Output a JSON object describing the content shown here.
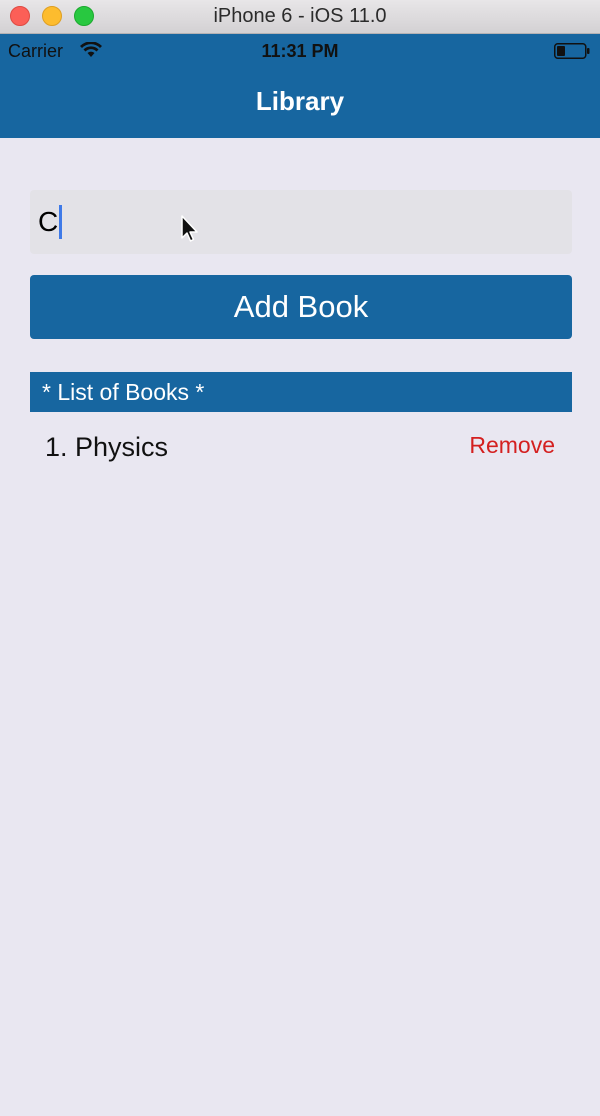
{
  "simulator": {
    "window_title": "iPhone 6 - iOS 11.0"
  },
  "status_bar": {
    "carrier": "Carrier",
    "time": "11:31 PM"
  },
  "nav": {
    "title": "Library"
  },
  "form": {
    "input_value": "C",
    "add_button_label": "Add Book"
  },
  "list": {
    "header": "* List of Books *",
    "items": [
      {
        "label": "1. Physics",
        "action": "Remove"
      }
    ]
  },
  "colors": {
    "primary": "#1766a0",
    "background": "#e9e7f1",
    "input_bg": "#e3e2e7",
    "remove": "#d42020",
    "caret": "#3f7ae8"
  }
}
